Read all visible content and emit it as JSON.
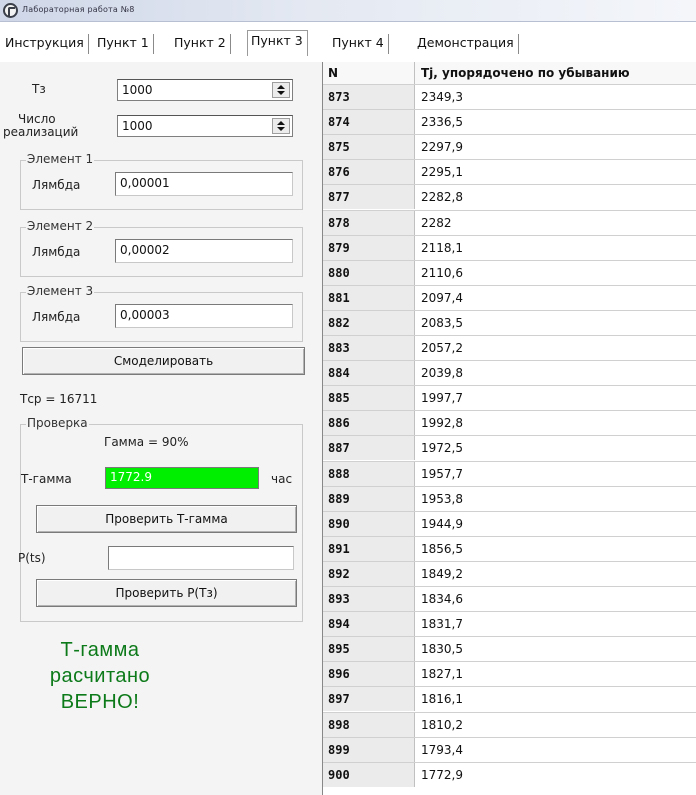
{
  "window": {
    "title": "Лабораторная работа №8"
  },
  "tabs": [
    {
      "label": "Инструкция",
      "active": false
    },
    {
      "label": "Пункт 1",
      "active": false
    },
    {
      "label": "Пункт 2",
      "active": false
    },
    {
      "label": "Пункт 3",
      "active": true
    },
    {
      "label": "Пункт 4",
      "active": false
    },
    {
      "label": "Демонстрация",
      "active": false
    }
  ],
  "params": {
    "ts_label": "Тз",
    "ts_value": "1000",
    "realizations_label_line1": "Число",
    "realizations_label_line2": "реализаций",
    "realizations_value": "1000"
  },
  "elements": [
    {
      "caption": "Элемент 1",
      "lambda_label": "Лямбда",
      "lambda_value": "0,00001"
    },
    {
      "caption": "Элемент 2",
      "lambda_label": "Лямбда",
      "lambda_value": "0,00002"
    },
    {
      "caption": "Элемент 3",
      "lambda_label": "Лямбда",
      "lambda_value": "0,00003"
    }
  ],
  "simulate_button": "Смоделировать",
  "tcp_text": "Тср = 16711",
  "check": {
    "caption": "Проверка",
    "gamma_text": "Гамма = 90%",
    "tgamma_label": "Т-гамма",
    "tgamma_value": "1772.9",
    "tgamma_unit": "час",
    "check_tgamma_button": "Проверить Т-гамма",
    "p_label": "P(ts)",
    "p_value": "",
    "check_p_button": "Проверить Р(Тз)"
  },
  "verdict": {
    "line1": "Т-гамма",
    "line2": "расчитано",
    "line3": "ВЕРНО!",
    "color": "#0d7a1a"
  },
  "table": {
    "col_n": "N",
    "col_t": "Tj, упорядочено по убыванию",
    "rows": [
      {
        "n": "873",
        "t": "2349,3"
      },
      {
        "n": "874",
        "t": "2336,5"
      },
      {
        "n": "875",
        "t": "2297,9"
      },
      {
        "n": "876",
        "t": "2295,1"
      },
      {
        "n": "877",
        "t": "2282,8"
      },
      {
        "n": "878",
        "t": "2282"
      },
      {
        "n": "879",
        "t": "2118,1"
      },
      {
        "n": "880",
        "t": "2110,6"
      },
      {
        "n": "881",
        "t": "2097,4"
      },
      {
        "n": "882",
        "t": "2083,5"
      },
      {
        "n": "883",
        "t": "2057,2"
      },
      {
        "n": "884",
        "t": "2039,8"
      },
      {
        "n": "885",
        "t": "1997,7"
      },
      {
        "n": "886",
        "t": "1992,8"
      },
      {
        "n": "887",
        "t": "1972,5"
      },
      {
        "n": "888",
        "t": "1957,7"
      },
      {
        "n": "889",
        "t": "1953,8"
      },
      {
        "n": "890",
        "t": "1944,9"
      },
      {
        "n": "891",
        "t": "1856,5"
      },
      {
        "n": "892",
        "t": "1849,2"
      },
      {
        "n": "893",
        "t": "1834,6"
      },
      {
        "n": "894",
        "t": "1831,7"
      },
      {
        "n": "895",
        "t": "1830,5"
      },
      {
        "n": "896",
        "t": "1827,1"
      },
      {
        "n": "897",
        "t": "1816,1"
      },
      {
        "n": "898",
        "t": "1810,2"
      },
      {
        "n": "899",
        "t": "1793,4"
      },
      {
        "n": "900",
        "t": "1772,9"
      }
    ]
  }
}
